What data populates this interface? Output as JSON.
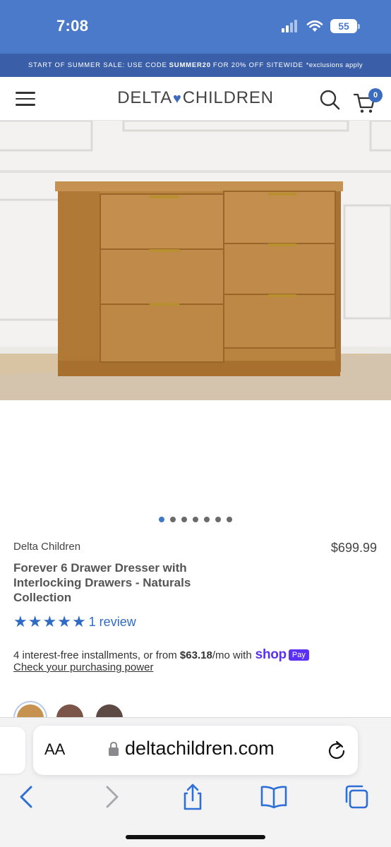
{
  "status_bar": {
    "time": "7:08",
    "battery": "55"
  },
  "promo": {
    "text_before": "START OF SUMMER SALE: USE CODE",
    "code": "SUMMER20",
    "text_after": "FOR 20% OFF SITEWIDE",
    "exclusions": "*exclusions apply"
  },
  "header": {
    "logo_left": "DELTA",
    "logo_right": "CHILDREN",
    "cart_count": "0",
    "icons": {
      "menu": "hamburger-menu-icon",
      "search": "search-icon",
      "cart": "cart-icon"
    }
  },
  "gallery": {
    "image_count": 7,
    "active_index": 0
  },
  "product": {
    "brand": "Delta Children",
    "price": "$699.99",
    "title": "Forever 6 Drawer Dresser with Interlocking Drawers - Naturals Collection",
    "rating_stars": 5,
    "review_text": "1 review",
    "installments_prefix": "4 interest-free installments, or from",
    "installments_amount": "$63.18",
    "installments_suffix": "/mo with",
    "shop_label": "shop",
    "pay_label": "Pay",
    "check_link": "Check your purchasing power"
  },
  "swatches": [
    {
      "color": "#c6924f"
    },
    {
      "color": "#7b5648"
    },
    {
      "color": "#5e4a45"
    }
  ],
  "safari": {
    "aa_label": "AA",
    "url": "deltachildren.com",
    "icons": [
      "back-icon",
      "forward-icon",
      "share-icon",
      "bookmarks-icon",
      "tabs-icon"
    ]
  },
  "colors": {
    "accent": "#2f6bc5",
    "status_bar": "#4a7ac9",
    "promo": "#3a5fa8",
    "shop_pay": "#5a31f4"
  }
}
